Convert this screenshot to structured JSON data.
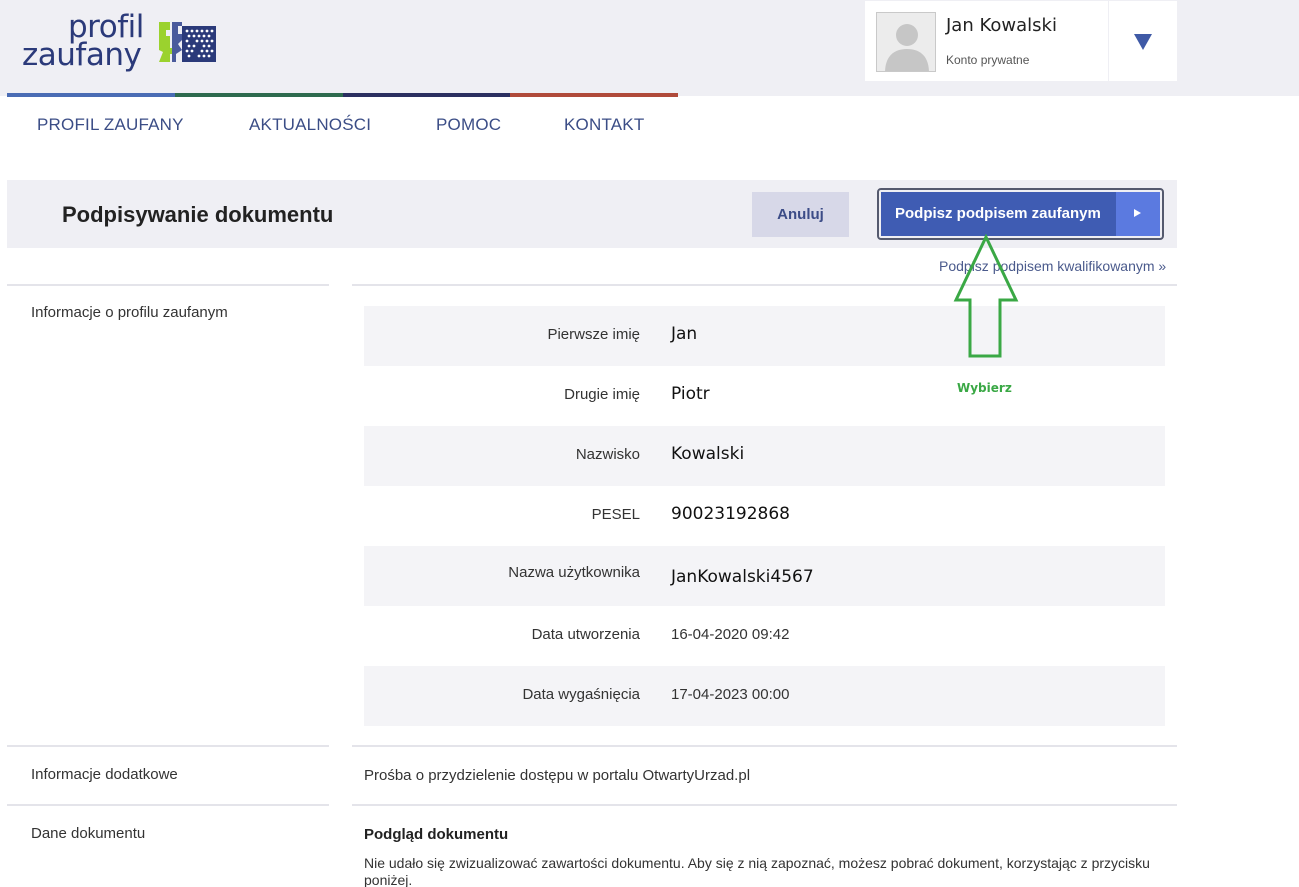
{
  "logo": {
    "line1": "profil",
    "line2": "zaufany",
    "colors": {
      "text": "#2b3a7a",
      "green": "#9bd22e",
      "navy": "#2b3a7a"
    }
  },
  "user": {
    "name": "Jan Kowalski",
    "account_type": "Konto prywatne",
    "avatar_icon": "user-silhouette-icon",
    "toggle_icon": "triangle-down-icon"
  },
  "nav": {
    "items": [
      {
        "label": "PROFIL ZAUFANY"
      },
      {
        "label": "AKTUALNOŚCI"
      },
      {
        "label": "POMOC"
      },
      {
        "label": "KONTAKT"
      }
    ],
    "accent_colors": [
      "#4a6cb4",
      "#2e6b4e",
      "#2b2f60",
      "#b04a3a"
    ]
  },
  "page": {
    "title": "Podpisywanie dokumentu",
    "cancel_label": "Anuluj",
    "sign_label": "Podpisz podpisem zaufanym",
    "qualified_link": "Podpisz podpisem kwalifikowanym »"
  },
  "profile_section": {
    "label": "Informacje o profilu zaufanym",
    "rows": [
      {
        "label": "Pierwsze imię",
        "value": "Jan"
      },
      {
        "label": "Drugie imię",
        "value": "Piotr"
      },
      {
        "label": "Nazwisko",
        "value": "Kowalski"
      },
      {
        "label": "PESEL",
        "value": "90023192868"
      },
      {
        "label": "Nazwa użytkownika",
        "value": "JanKowalski4567"
      },
      {
        "label": "Data utworzenia",
        "value": "16-04-2020 09:42"
      },
      {
        "label": "Data wygaśnięcia",
        "value": "17-04-2023 00:00"
      }
    ]
  },
  "extra_section": {
    "label": "Informacje dodatkowe",
    "text": "Prośba o przydzielenie dostępu w portalu OtwartyUrzad.pl"
  },
  "document_section": {
    "label": "Dane dokumentu",
    "preview_title": "Podgląd dokumentu",
    "preview_text": "Nie udało się zwizualizować zawartości dokumentu. Aby się z nią zapoznać, możesz pobrać dokument, korzystając z przycisku poniżej."
  },
  "annotation": {
    "label": "Wybierz",
    "color": "#3aa845",
    "icon": "arrow-up-icon"
  }
}
